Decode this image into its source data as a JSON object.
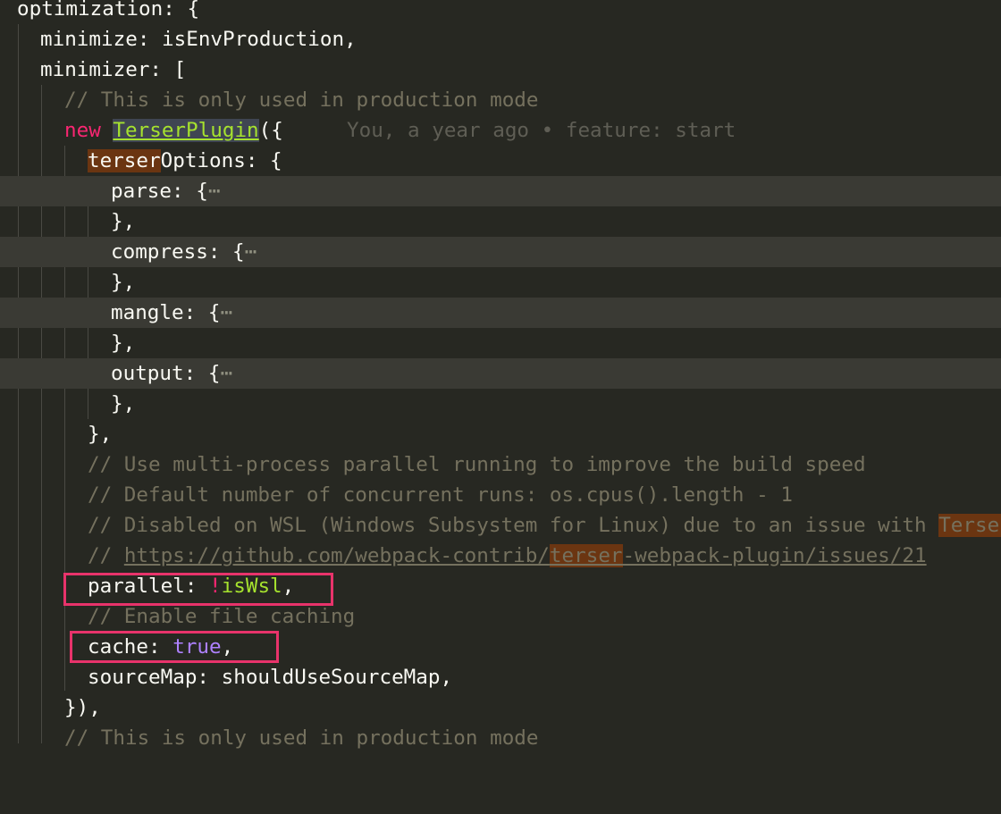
{
  "code": {
    "l1_key": "optimization",
    "l1_rest": ": {",
    "l2": "minimize: isEnvProduction,",
    "l3": "minimizer: [",
    "l4": "// This is only used in production mode",
    "l5_new": "new",
    "l5_space": " ",
    "l5_cls": "TerserPlugin",
    "l5_paren": "({",
    "l5_blame": "You, a year ago • feature: start",
    "l6_hl": "terser",
    "l6_rest": "Options: {",
    "l7": "parse: {",
    "l8": "},",
    "l9": "compress: {",
    "l10": "},",
    "l11": "mangle: {",
    "l12": "},",
    "l13": "output: {",
    "l14": "},",
    "l15": "},",
    "ellipsis": "⋯",
    "l16": "// Use multi-process parallel running to improve the build speed",
    "l17": "// Default number of concurrent runs: os.cpus().length - 1",
    "l18_pre": "// Disabled on WSL (Windows Subsystem for Linux) due to an issue with ",
    "l18_hl": "Terser",
    "l19_pre": "// ",
    "l19_link1": "https://github.com/webpack-contrib/",
    "l19_hl": "terser",
    "l19_link2": "-webpack-plugin/issues/21",
    "l20_key": "parallel: ",
    "l20_bang": "!",
    "l20_val": "isWsl",
    "l20_comma": ",",
    "l21": "// Enable file caching",
    "l22_key": "cache: ",
    "l22_val": "true",
    "l22_comma": ",",
    "l23": "sourceMap: shouldUseSourceMap,",
    "l24": "}),",
    "l25": "// This is only used in production mode"
  },
  "colors": {
    "background": "#272822",
    "keyword": "#f92672",
    "class": "#a6e22e",
    "comment": "#75715e",
    "boolean": "#ae81ff",
    "annotation_box": "#e8336b",
    "search_highlight": "#6b3511"
  }
}
